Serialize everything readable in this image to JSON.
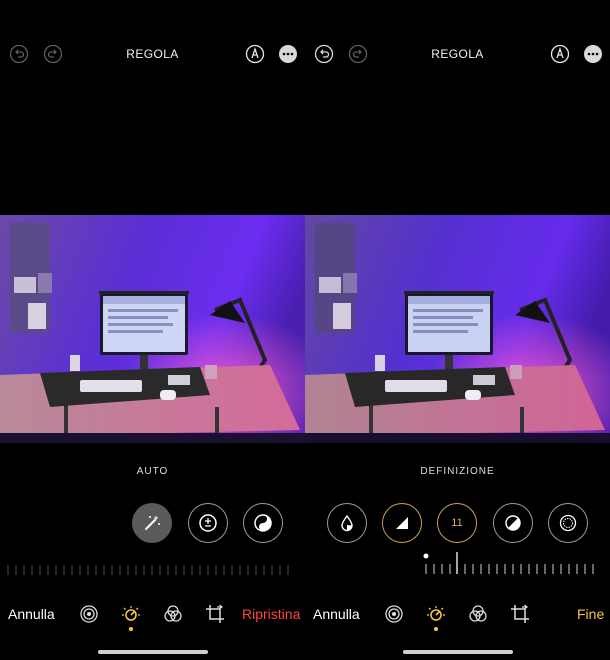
{
  "left": {
    "title": "REGOLA",
    "mode_label": "AUTO",
    "cancel_label": "Annulla",
    "reset_label": "Ripristina",
    "top_icons": [
      "undo-icon",
      "redo-icon",
      "markup-icon",
      "more-icon"
    ],
    "tools": [
      "magic-wand-icon",
      "exposure-icon",
      "brilliance-icon"
    ],
    "bottom_icons": [
      "live-icon",
      "adjust-icon",
      "filters-icon",
      "crop-icon"
    ]
  },
  "right": {
    "title": "REGOLA",
    "mode_label": "DEFINIZIONE",
    "cancel_label": "Annulla",
    "done_label": "Fine",
    "definition_value": "11",
    "top_icons": [
      "undo-icon",
      "redo-icon",
      "markup-icon",
      "more-icon"
    ],
    "tools": [
      "tint-icon",
      "sharpness-icon",
      "definition-icon",
      "noise-reduction-icon",
      "vignette-icon"
    ],
    "bottom_icons": [
      "live-icon",
      "adjust-icon",
      "filters-icon",
      "crop-icon"
    ]
  },
  "colors": {
    "background": "#000000",
    "accent_gold": "#f5c542",
    "reset_red": "#ff453a"
  }
}
